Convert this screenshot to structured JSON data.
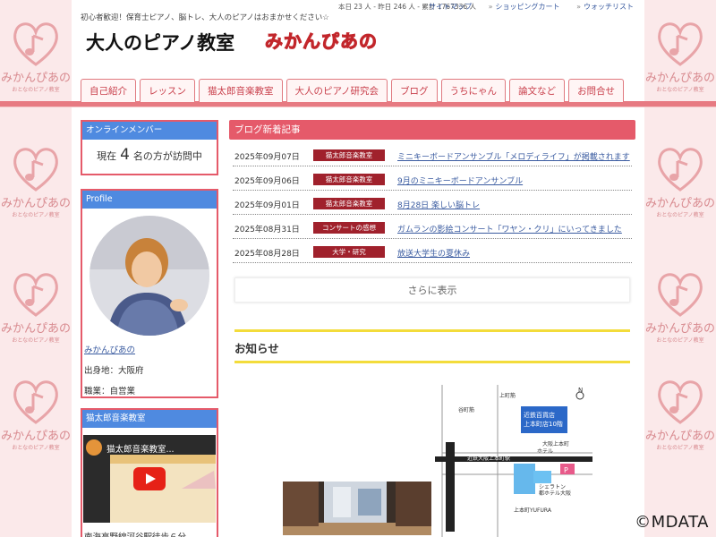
{
  "side_brand": {
    "name": "みかんぴあの",
    "sub": "おとなのピアノ教室"
  },
  "header": {
    "tagline": "初心者歓迎！保育士ピアノ、脳トレ、大人のピアノはおまかせください☆",
    "counter": "本日 23 人 - 昨日 246 人 - 累計 1767336 人",
    "links": [
      "サイトマップ",
      "ショッピングカート",
      "ウォッチリスト"
    ],
    "title": "大人のピアノ教室",
    "logo": "みかんぴあの"
  },
  "nav": [
    "自己紹介",
    "レッスン",
    "猫太郎音楽教室",
    "大人のピアノ研究会",
    "ブログ",
    "うちにゃん",
    "論文など",
    "お問合せ"
  ],
  "sidebar": {
    "online": {
      "title": "オンラインメンバー",
      "prefix": "現在",
      "count": "4",
      "suffix": "名の方が訪問中"
    },
    "profile": {
      "title": "Profile",
      "name": "みかんぴあの",
      "birthplace": "出身地：大阪府",
      "job": "職業：自営業"
    },
    "video": {
      "title": "猫太郎音楽教室",
      "video_title": "猫太郎音楽教室...",
      "caption": "南海高野線河谷駅徒歩６分"
    }
  },
  "main": {
    "blog_title": "ブログ新着記事",
    "posts": [
      {
        "date": "2025年09月07日",
        "category": "猫太郎音楽教室",
        "title": "ミニキーボードアンサンブル「メロディライフ」が掲載されます"
      },
      {
        "date": "2025年09月06日",
        "category": "猫太郎音楽教室",
        "title": "9月のミニキーボードアンサンブル"
      },
      {
        "date": "2025年09月01日",
        "category": "猫太郎音楽教室",
        "title": "8月28日 楽しい脳トレ"
      },
      {
        "date": "2025年08月31日",
        "category": "コンサートの感想",
        "title": "ガムランの影絵コンサート「ワヤン・クリ」にいってきました"
      },
      {
        "date": "2025年08月28日",
        "category": "大学・研究",
        "title": "放送大学生の夏休み"
      }
    ],
    "more": "さらに表示",
    "notice_title": "お知らせ"
  },
  "map": {
    "station": "近鉄大阪上本町駅",
    "store_line1": "近鉄百貨店",
    "store_line2": "上本町店10階",
    "hotel_line1": "シェラトン",
    "hotel_line2": "都ホテル大阪",
    "yufura": "上本町YUFURA",
    "street_left": "谷町筋",
    "street_right": "上町筋",
    "label_n": "N",
    "label_osaka": "大阪上本町",
    "label_hotel": "ホテル",
    "p_mark": "P"
  },
  "watermark": "©MDATA",
  "colors": {
    "accent": "#e55a6a",
    "nav_border": "#e07a80",
    "head_blue": "#4f8ae0",
    "cat_red": "#a0212c",
    "logo": "#e63b3b"
  }
}
